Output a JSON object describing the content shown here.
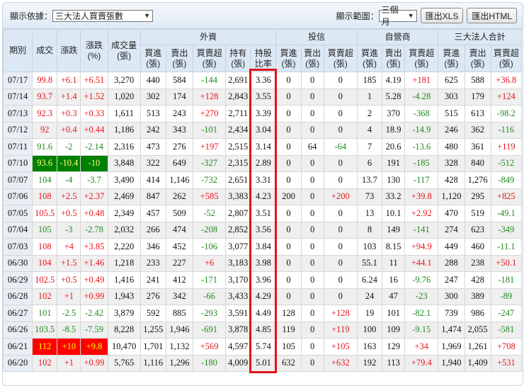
{
  "toolbar": {
    "basis_label": "顯示依據：",
    "basis_value": "三大法人買賣張數",
    "range_label": "顯示範圍：",
    "range_value": "三個月",
    "export_xls": "匯出XLS",
    "export_html": "匯出HTML"
  },
  "header": {
    "period": "期別",
    "close": "成交",
    "change": "漲跌",
    "change_pct": "漲跌\n(%)",
    "volume": "成交量\n(張)",
    "groups": [
      "外資",
      "投信",
      "自營商",
      "三大法人合計"
    ],
    "buy": "買進\n(張)",
    "sell": "賣出\n(張)",
    "net": "買賣超\n(張)",
    "hold": "持有\n(張)",
    "hold_ratio": "持股\n比率"
  },
  "rows": [
    {
      "c": [
        "07/17",
        "99.8",
        "+6.1",
        "+6.51",
        "3,270",
        "440",
        "584",
        "-144",
        "2,691",
        "3.36",
        "0",
        "0",
        "0",
        "185",
        "4.19",
        "+181",
        "625",
        "588",
        "+36.8"
      ]
    },
    {
      "c": [
        "07/14",
        "93.7",
        "+1.4",
        "+1.52",
        "1,020",
        "302",
        "174",
        "+128",
        "2,843",
        "3.55",
        "0",
        "0",
        "0",
        "1",
        "5.28",
        "-4.28",
        "303",
        "179",
        "+124"
      ]
    },
    {
      "c": [
        "07/13",
        "92.3",
        "+0.3",
        "+0.33",
        "1,611",
        "513",
        "243",
        "+270",
        "2,711",
        "3.39",
        "0",
        "0",
        "0",
        "2",
        "370",
        "-368",
        "515",
        "613",
        "-98.2"
      ]
    },
    {
      "c": [
        "07/12",
        "92",
        "+0.4",
        "+0.44",
        "1,186",
        "242",
        "343",
        "-101",
        "2,434",
        "3.04",
        "0",
        "0",
        "0",
        "4",
        "18.9",
        "-14.9",
        "246",
        "362",
        "-116"
      ]
    },
    {
      "c": [
        "07/11",
        "91.6",
        "-2",
        "-2.14",
        "2,316",
        "473",
        "276",
        "+197",
        "2,515",
        "3.14",
        "0",
        "64",
        "-64",
        "7",
        "20.6",
        "-13.6",
        "480",
        "361",
        "+119"
      ]
    },
    {
      "c": [
        "07/10",
        "93.6",
        "-10.4",
        "-10",
        "3,848",
        "322",
        "649",
        "-327",
        "2,315",
        "2.89",
        "0",
        "0",
        "0",
        "6",
        "191",
        "-185",
        "328",
        "840",
        "-512"
      ],
      "hl": "limit-down"
    },
    {
      "c": [
        "07/07",
        "104",
        "-4",
        "-3.7",
        "3,490",
        "414",
        "1,146",
        "-732",
        "2,651",
        "3.31",
        "0",
        "0",
        "0",
        "13.7",
        "130",
        "-117",
        "428",
        "1,276",
        "-849"
      ]
    },
    {
      "c": [
        "07/06",
        "108",
        "+2.5",
        "+2.37",
        "2,469",
        "847",
        "262",
        "+585",
        "3,383",
        "4.23",
        "200",
        "0",
        "+200",
        "73",
        "33.2",
        "+39.8",
        "1,120",
        "295",
        "+825"
      ]
    },
    {
      "c": [
        "07/05",
        "105.5",
        "+0.5",
        "+0.48",
        "2,349",
        "457",
        "509",
        "-52",
        "2,807",
        "3.51",
        "0",
        "0",
        "0",
        "13",
        "10.1",
        "+2.92",
        "470",
        "519",
        "-49.1"
      ]
    },
    {
      "c": [
        "07/04",
        "105",
        "-3",
        "-2.78",
        "2,032",
        "266",
        "474",
        "-208",
        "2,852",
        "3.56",
        "0",
        "0",
        "0",
        "8",
        "149",
        "-141",
        "274",
        "623",
        "-349"
      ]
    },
    {
      "c": [
        "07/03",
        "108",
        "+4",
        "+3.85",
        "2,220",
        "346",
        "452",
        "-106",
        "3,077",
        "3.84",
        "0",
        "0",
        "0",
        "103",
        "8.15",
        "+94.9",
        "449",
        "460",
        "-11.1"
      ]
    },
    {
      "c": [
        "06/30",
        "104",
        "+1.5",
        "+1.46",
        "1,218",
        "233",
        "227",
        "+6",
        "3,183",
        "3.98",
        "0",
        "0",
        "0",
        "55.1",
        "11",
        "+44.1",
        "288",
        "238",
        "+50.1"
      ]
    },
    {
      "c": [
        "06/29",
        "102.5",
        "+0.5",
        "+0.49",
        "1,416",
        "241",
        "412",
        "-171",
        "3,170",
        "3.96",
        "0",
        "0",
        "0",
        "6.24",
        "16",
        "-9.76",
        "247",
        "428",
        "-181"
      ]
    },
    {
      "c": [
        "06/28",
        "102",
        "+1",
        "+0.99",
        "1,943",
        "276",
        "342",
        "-66",
        "3,433",
        "4.29",
        "0",
        "0",
        "0",
        "24",
        "47",
        "-23",
        "300",
        "389",
        "-89"
      ]
    },
    {
      "c": [
        "06/27",
        "101",
        "-2.5",
        "-2.42",
        "3,879",
        "592",
        "885",
        "-293",
        "3,591",
        "4.49",
        "128",
        "0",
        "+128",
        "19",
        "101",
        "-82.1",
        "739",
        "986",
        "-247"
      ]
    },
    {
      "c": [
        "06/26",
        "103.5",
        "-8.5",
        "-7.59",
        "8,228",
        "1,255",
        "1,946",
        "-691",
        "3,878",
        "4.85",
        "119",
        "0",
        "+119",
        "100",
        "109",
        "-9.15",
        "1,474",
        "2,055",
        "-581"
      ]
    },
    {
      "c": [
        "06/21",
        "112",
        "+10",
        "+9.8",
        "10,470",
        "1,701",
        "1,132",
        "+569",
        "4,597",
        "5.74",
        "105",
        "0",
        "+105",
        "163",
        "129",
        "+34",
        "1,969",
        "1,261",
        "+708"
      ],
      "hl": "limit-up"
    },
    {
      "c": [
        "06/20",
        "102",
        "+1",
        "+0.99",
        "5,765",
        "1,116",
        "1,296",
        "-180",
        "4,009",
        "5.01",
        "632",
        "0",
        "+632",
        "192",
        "113",
        "+79.4",
        "1,940",
        "1,409",
        "+531"
      ]
    }
  ],
  "colors": {
    "up": "#e8141a",
    "down": "#1f8a1f",
    "header_bg": "#dce9f5",
    "highlight_box": "#e0141c"
  }
}
